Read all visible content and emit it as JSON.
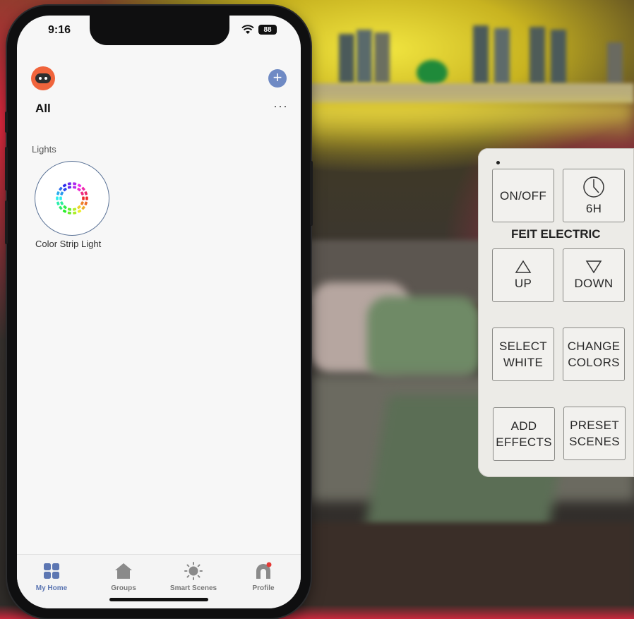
{
  "status": {
    "time": "9:16",
    "battery": "88"
  },
  "header": {
    "title": "All",
    "more_label": "···",
    "add_label": "+"
  },
  "section": {
    "label": "Lights"
  },
  "devices": [
    {
      "name": "Color Strip Light",
      "icon": "color-strip-light-icon"
    }
  ],
  "tabs": [
    {
      "label": "My Home",
      "icon": "my-home-icon",
      "active": true
    },
    {
      "label": "Groups",
      "icon": "groups-icon",
      "active": false
    },
    {
      "label": "Smart Scenes",
      "icon": "smart-scenes-icon",
      "active": false
    },
    {
      "label": "Profile",
      "icon": "profile-icon",
      "active": false
    }
  ],
  "colors": {
    "accent": "#5c76b2",
    "logo": "#f0643c",
    "background": "#f7f7f7"
  },
  "remote": {
    "brand": "FEIT ELECTRIC",
    "buttons": [
      {
        "line1": "ON/OFF",
        "line2": ""
      },
      {
        "line1": "6H",
        "line2": "",
        "icon": "clock-icon"
      },
      {
        "line1": "UP",
        "line2": "",
        "icon": "up-triangle-icon"
      },
      {
        "line1": "DOWN",
        "line2": "",
        "icon": "down-triangle-icon"
      },
      {
        "line1": "SELECT",
        "line2": "WHITE"
      },
      {
        "line1": "CHANGE",
        "line2": "COLORS"
      },
      {
        "line1": "ADD",
        "line2": "EFFECTS"
      },
      {
        "line1": "PRESET",
        "line2": "SCENES"
      }
    ]
  }
}
